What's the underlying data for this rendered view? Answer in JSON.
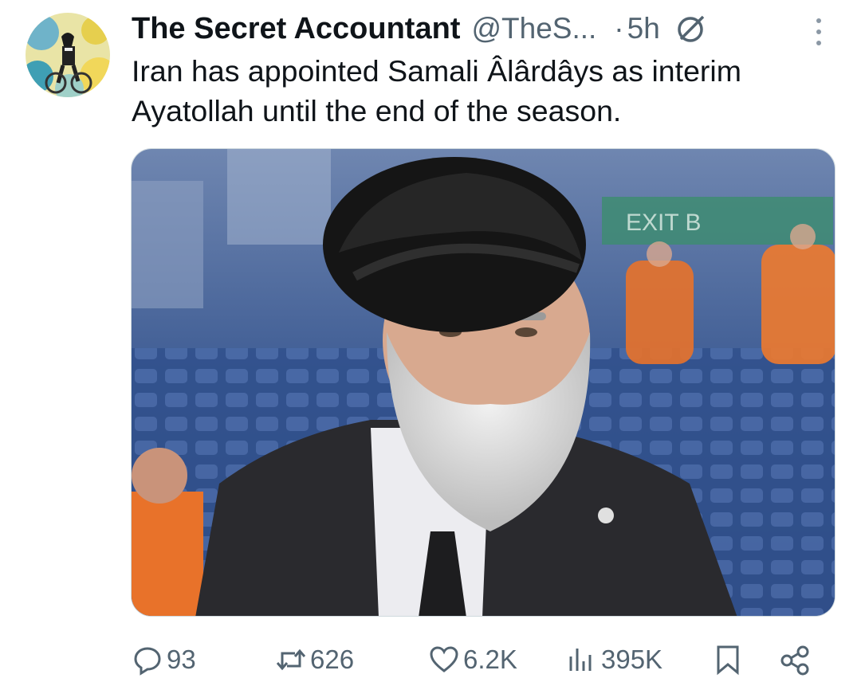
{
  "tweet": {
    "author_name": "The Secret Accountant",
    "handle": "@TheS...",
    "separator": "·",
    "time": "5h",
    "text": "Iran has appointed Samali Âlârdâys as interim Ayatollah until the end of the season."
  },
  "actions": {
    "replies": "93",
    "reposts": "626",
    "likes": "6.2K",
    "views": "395K"
  },
  "media": {
    "background_sign": "EXIT B"
  },
  "icons": {
    "premium": "blocked-circle-icon",
    "more": "vertical-dots-icon",
    "reply": "speech-bubble-icon",
    "repost": "repost-arrows-icon",
    "like": "heart-icon",
    "views": "bar-chart-icon",
    "bookmark": "bookmark-icon",
    "share": "share-nodes-icon"
  },
  "colors": {
    "text_primary": "#0f1419",
    "text_secondary": "#536471",
    "seat_blue": "#2f4f86",
    "steward_orange": "#e8722a"
  }
}
